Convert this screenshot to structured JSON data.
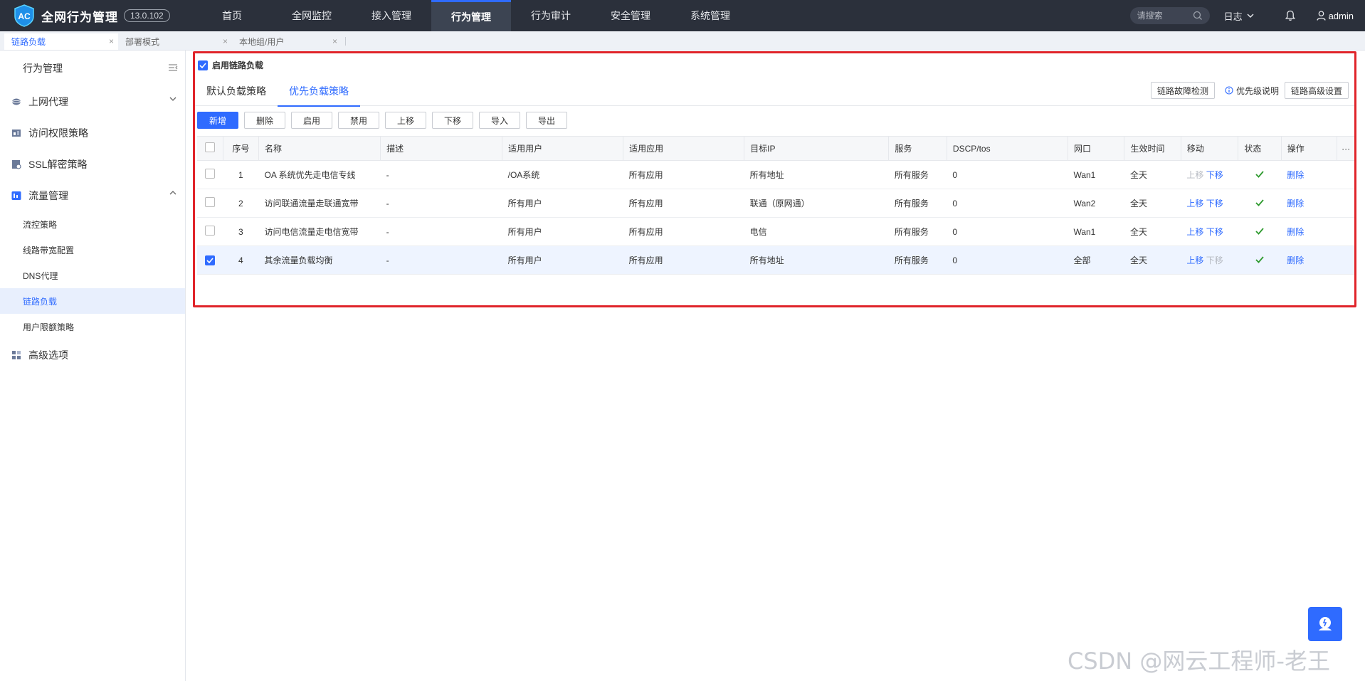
{
  "app": {
    "logo_text": "AC",
    "title": "全网行为管理",
    "version": "13.0.102"
  },
  "nav": [
    {
      "label": "首页"
    },
    {
      "label": "全网监控"
    },
    {
      "label": "接入管理"
    },
    {
      "label": "行为管理",
      "active": true
    },
    {
      "label": "行为审计"
    },
    {
      "label": "安全管理"
    },
    {
      "label": "系统管理"
    }
  ],
  "topright": {
    "search_placeholder": "请搜索",
    "log_label": "日志",
    "user": "admin"
  },
  "page_tabs": [
    {
      "label": "链路负载",
      "active": true
    },
    {
      "label": "部署模式"
    },
    {
      "label": "本地组/用户"
    }
  ],
  "sidebar": {
    "header": "行为管理",
    "groups": {
      "proxy": "上网代理",
      "access": "访问权限策略",
      "ssl": "SSL解密策略",
      "traffic": "流量管理",
      "advanced": "高级选项"
    },
    "traffic_items": [
      "流控策略",
      "线路带宽配置",
      "DNS代理",
      "链路负载",
      "用户限额策略"
    ],
    "active_item": "链路负载"
  },
  "content": {
    "enable_label": "启用链路负载",
    "enable_checked": true,
    "tabs": [
      "默认负载策略",
      "优先负载策略"
    ],
    "active_tab": "优先负载策略",
    "fault_detect": "链路故障检测",
    "priority_note": "优先级说明",
    "advanced_settings": "链路高级设置",
    "toolbar": [
      "新增",
      "删除",
      "启用",
      "禁用",
      "上移",
      "下移",
      "导入",
      "导出"
    ]
  },
  "table": {
    "columns": [
      "序号",
      "名称",
      "描述",
      "适用用户",
      "适用应用",
      "目标IP",
      "服务",
      "DSCP/tos",
      "网口",
      "生效时间",
      "移动",
      "状态",
      "操作"
    ],
    "more": "···",
    "rows": [
      {
        "no": "1",
        "name": "OA 系统优先走电信专线",
        "desc": "-",
        "user": "/OA系统",
        "app": "所有应用",
        "ip": "所有地址",
        "service": "所有服务",
        "dscp": "0",
        "port": "Wan1",
        "time": "全天",
        "up": "上移",
        "down": "下移",
        "up_enabled": false,
        "down_enabled": true,
        "op": "删除",
        "checked": false
      },
      {
        "no": "2",
        "name": "访问联通流量走联通宽带",
        "desc": "-",
        "user": "所有用户",
        "app": "所有应用",
        "ip": "联通（原网通）",
        "service": "所有服务",
        "dscp": "0",
        "port": "Wan2",
        "time": "全天",
        "up": "上移",
        "down": "下移",
        "up_enabled": true,
        "down_enabled": true,
        "op": "删除",
        "checked": false
      },
      {
        "no": "3",
        "name": "访问电信流量走电信宽带",
        "desc": "-",
        "user": "所有用户",
        "app": "所有应用",
        "ip": "电信",
        "service": "所有服务",
        "dscp": "0",
        "port": "Wan1",
        "time": "全天",
        "up": "上移",
        "down": "下移",
        "up_enabled": true,
        "down_enabled": true,
        "op": "删除",
        "checked": false
      },
      {
        "no": "4",
        "name": "其余流量负载均衡",
        "desc": "-",
        "user": "所有用户",
        "app": "所有应用",
        "ip": "所有地址",
        "service": "所有服务",
        "dscp": "0",
        "port": "全部",
        "time": "全天",
        "up": "上移",
        "down": "下移",
        "up_enabled": true,
        "down_enabled": false,
        "op": "删除",
        "checked": true
      }
    ]
  },
  "watermark": "CSDN @网云工程师-老王",
  "colors": {
    "accent": "#2f6bff",
    "topbar": "#2b303b",
    "highlight_border": "#e0242a",
    "status_ok": "#2e9a2e"
  }
}
